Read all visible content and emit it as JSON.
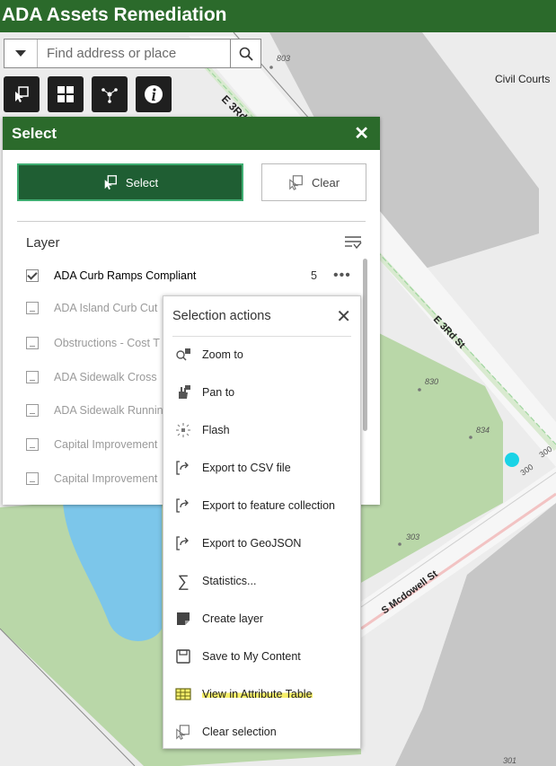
{
  "app": {
    "title": "ADA Assets Remediation"
  },
  "search": {
    "placeholder": "Find address or place"
  },
  "map_labels": {
    "l803": "803",
    "civil_courts": "Civil Courts",
    "e3rd_upper": "E 3Rd",
    "e3rd_st": "E 3Rd St",
    "l830": "830",
    "l834": "834",
    "l300a": "300",
    "l300b": "300",
    "l303": "303",
    "s_mcdowell": "S Mcdowell St",
    "l301": "301"
  },
  "select_panel": {
    "title": "Select",
    "select_label": "Select",
    "clear_label": "Clear",
    "layer_heading": "Layer",
    "layers": [
      {
        "name": "ADA Curb Ramps Compliant",
        "count": "5",
        "checked": true
      },
      {
        "name": "ADA Island Curb Cut"
      },
      {
        "name": "Obstructions - Cost T"
      },
      {
        "name": "ADA Sidewalk Cross"
      },
      {
        "name": "ADA Sidewalk Runnin"
      },
      {
        "name": "Capital Improvement"
      },
      {
        "name": "Capital Improvement"
      }
    ]
  },
  "actions_menu": {
    "title": "Selection actions",
    "items": [
      {
        "label": "Zoom to",
        "icon": "zoom-to-icon"
      },
      {
        "label": "Pan to",
        "icon": "pan-hand-icon"
      },
      {
        "label": "Flash",
        "icon": "flash-icon"
      },
      {
        "label": "Export to CSV file",
        "icon": "export-icon"
      },
      {
        "label": "Export to feature collection",
        "icon": "export-icon"
      },
      {
        "label": "Export to GeoJSON",
        "icon": "export-icon"
      },
      {
        "label": "Statistics...",
        "icon": "sigma-icon"
      },
      {
        "label": "Create layer",
        "icon": "create-layer-icon"
      },
      {
        "label": "Save to My Content",
        "icon": "save-icon"
      },
      {
        "label": "View in Attribute Table",
        "icon": "table-icon",
        "highlighted": true
      },
      {
        "label": "Clear selection",
        "icon": "clear-selection-icon"
      }
    ]
  },
  "colors": {
    "header_green": "#2b6a2b",
    "select_button": "#1f5e33",
    "highlight": "#f7f06a",
    "feature_cyan": "#19d3e6"
  }
}
